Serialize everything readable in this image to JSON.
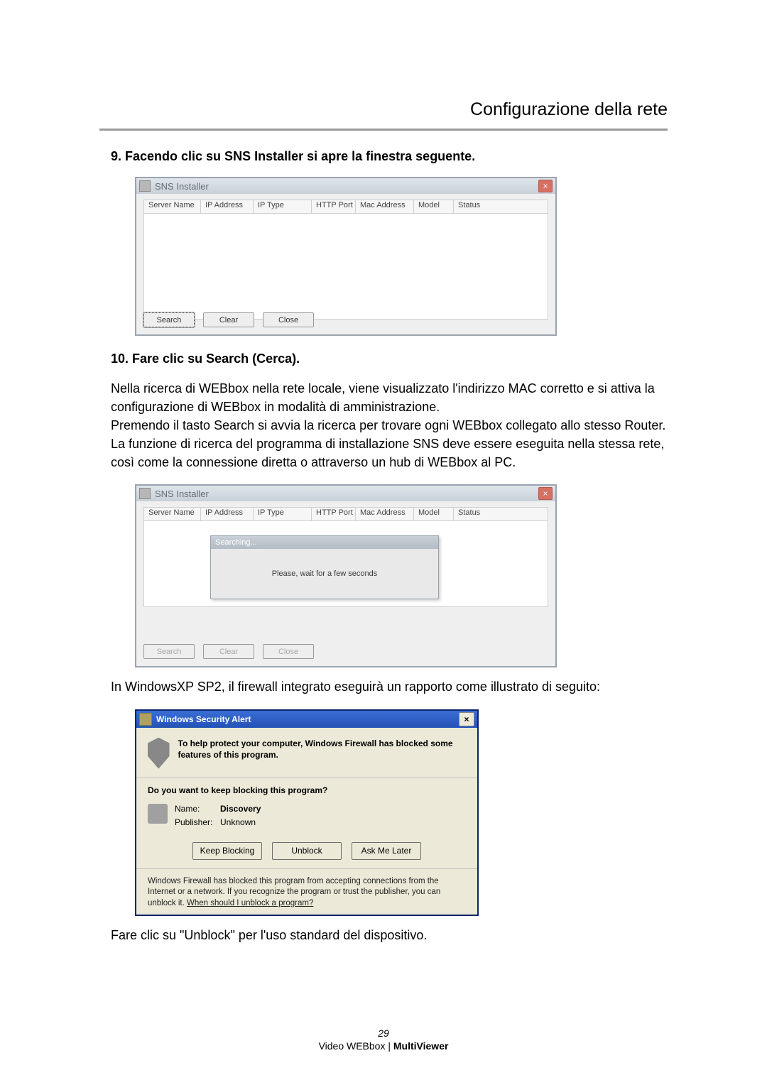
{
  "header": {
    "title": "Configurazione della rete"
  },
  "steps": {
    "s9": "9. Facendo clic su SNS Installer si apre la finestra seguente.",
    "s10": "10. Fare clic su Search (Cerca)."
  },
  "para1": "Nella ricerca di  WEBbox nella rete locale, viene visualizzato l'indirizzo MAC corretto e si attiva la configurazione di WEBbox in modalità di amministrazione.\nPremendo il tasto Search si avvia la ricerca per trovare ogni WEBbox collegato allo stesso Router.\nLa funzione di ricerca del programma di installazione SNS deve essere eseguita nella stessa rete, così come la connessione diretta o attraverso un hub di WEBbox al PC.",
  "para2": "In WindowsXP SP2, il firewall integrato eseguirà un rapporto come illustrato di seguito:",
  "para3": "Fare clic su \"Unblock\" per l'uso standard del dispositivo.",
  "sns": {
    "title": "SNS Installer",
    "cols": {
      "server_name": "Server Name",
      "ip_address": "IP Address",
      "ip_type": "IP Type",
      "http_port": "HTTP Port",
      "mac_address": "Mac Address",
      "model": "Model",
      "status": "Status"
    },
    "buttons": {
      "search": "Search",
      "clear": "Clear",
      "close": "Close"
    },
    "searching": {
      "title": "Searching...",
      "msg": "Please, wait for a few seconds"
    }
  },
  "alert": {
    "title": "Windows Security Alert",
    "msg": "To help protect your computer,  Windows Firewall has blocked some features of this program.",
    "question": "Do you want to keep blocking this program?",
    "name_label": "Name:",
    "name_value": "Discovery",
    "pub_label": "Publisher:",
    "pub_value": "Unknown",
    "buttons": {
      "keep": "Keep Blocking",
      "unblock": "Unblock",
      "ask": "Ask Me Later"
    },
    "note1": "Windows Firewall has blocked this program from accepting connections from the Internet or a network. If you recognize the program or trust the publisher, you can unblock it. ",
    "note_link": "When should I unblock a program?"
  },
  "footer": {
    "page": "29",
    "prod_a": "Video WEBbox | ",
    "prod_b": "MultiViewer"
  }
}
